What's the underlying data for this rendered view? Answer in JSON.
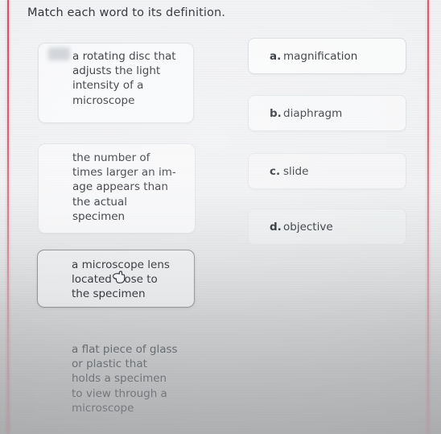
{
  "screen": {
    "prompt": "Match each word to its definition."
  },
  "definitions": [
    {
      "id": "definition-card-1",
      "text": "a rotating disc that\nadjusts the light\nintensity of a\nmicroscope",
      "state": "default"
    },
    {
      "id": "definition-card-2",
      "text": "the number of\ntimes larger an im-\nage appears than\nthe actual\nspecimen",
      "state": "default"
    },
    {
      "id": "definition-card-3",
      "text": "a microscope lens\nlocated close to\nthe specimen",
      "state": "selected"
    },
    {
      "id": "definition-card-4",
      "text": "a flat piece of glass\nor plastic that\nholds a specimen\nto view through a\nmicroscope",
      "state": "default"
    }
  ],
  "options": [
    {
      "letter": "a.",
      "word": "magnification"
    },
    {
      "letter": "b.",
      "word": "diaphragm"
    },
    {
      "letter": "c.",
      "word": "slide"
    },
    {
      "letter": "d.",
      "word": "objective"
    }
  ],
  "cursor": {
    "icon": "hand-pointer-cursor"
  },
  "colors": {
    "page_edge_line": "#e23e55",
    "text": "#303338",
    "selected_card_border": "#8d9296",
    "card_background": "#f9fafb"
  }
}
